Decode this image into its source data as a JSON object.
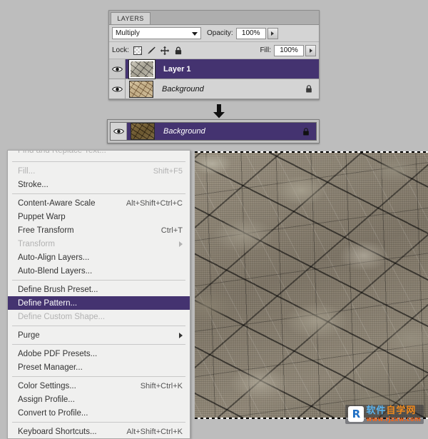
{
  "app": {
    "background_color": "#bdbdbd",
    "selection_purple": "#443370"
  },
  "layers_panel": {
    "tab_label": "LAYERS",
    "blend_mode": {
      "value": "Multiply",
      "icon": "chevron-down-icon"
    },
    "opacity": {
      "label": "Opacity:",
      "value": "100%"
    },
    "fill": {
      "label": "Fill:",
      "value": "100%"
    },
    "lock": {
      "label": "Lock:",
      "icons": [
        "lock-transparent-pixels-icon",
        "lock-image-pixels-icon",
        "lock-position-icon",
        "lock-all-icon"
      ]
    },
    "layers": [
      {
        "name": "Layer 1",
        "selected": true,
        "visible": true,
        "locked": false,
        "italic": false,
        "thumbnail": "gray-cracked-texture"
      },
      {
        "name": "Background",
        "selected": false,
        "visible": true,
        "locked": true,
        "italic": true,
        "thumbnail": "tan-cracked-texture"
      }
    ]
  },
  "flow_arrow": {
    "icon": "arrow-down-icon"
  },
  "result_panel": {
    "layer": {
      "name": "Background",
      "selected": true,
      "visible": true,
      "locked": true,
      "italic": true,
      "thumbnail": "dark-brown-cracked-texture"
    }
  },
  "edit_menu": {
    "items": [
      {
        "label": "Find and Replace Text...",
        "shortcut": "",
        "state": "clipped",
        "submenu": false
      },
      {
        "separator": true
      },
      {
        "label": "Fill...",
        "shortcut": "Shift+F5",
        "state": "disabled",
        "submenu": false
      },
      {
        "label": "Stroke...",
        "shortcut": "",
        "state": "normal",
        "submenu": false
      },
      {
        "separator": true
      },
      {
        "label": "Content-Aware Scale",
        "shortcut": "Alt+Shift+Ctrl+C",
        "state": "normal",
        "submenu": false
      },
      {
        "label": "Puppet Warp",
        "shortcut": "",
        "state": "normal",
        "submenu": false
      },
      {
        "label": "Free Transform",
        "shortcut": "Ctrl+T",
        "state": "normal",
        "submenu": false
      },
      {
        "label": "Transform",
        "shortcut": "",
        "state": "disabled",
        "submenu": true
      },
      {
        "label": "Auto-Align Layers...",
        "shortcut": "",
        "state": "normal",
        "submenu": false
      },
      {
        "label": "Auto-Blend Layers...",
        "shortcut": "",
        "state": "normal",
        "submenu": false
      },
      {
        "separator": true
      },
      {
        "label": "Define Brush Preset...",
        "shortcut": "",
        "state": "normal",
        "submenu": false
      },
      {
        "label": "Define Pattern...",
        "shortcut": "",
        "state": "highlighted",
        "submenu": false
      },
      {
        "label": "Define Custom Shape...",
        "shortcut": "",
        "state": "disabled",
        "submenu": false
      },
      {
        "separator": true
      },
      {
        "label": "Purge",
        "shortcut": "",
        "state": "normal",
        "submenu": true
      },
      {
        "separator": true
      },
      {
        "label": "Adobe PDF Presets...",
        "shortcut": "",
        "state": "normal",
        "submenu": false
      },
      {
        "label": "Preset Manager...",
        "shortcut": "",
        "state": "normal",
        "submenu": false
      },
      {
        "separator": true
      },
      {
        "label": "Color Settings...",
        "shortcut": "Shift+Ctrl+K",
        "state": "normal",
        "submenu": false
      },
      {
        "label": "Assign Profile...",
        "shortcut": "",
        "state": "normal",
        "submenu": false
      },
      {
        "label": "Convert to Profile...",
        "shortcut": "",
        "state": "normal",
        "submenu": false
      },
      {
        "separator": true
      },
      {
        "label": "Keyboard Shortcuts...",
        "shortcut": "Alt+Shift+Ctrl+K",
        "state": "normal",
        "submenu": false
      }
    ]
  },
  "canvas": {
    "content": "cracked-dry-earth-texture",
    "selection_marquee": true
  },
  "watermark": {
    "logo_letter": "R",
    "cn_part1": "软件",
    "cn_part2": "自学网",
    "url": "www.rjzxw.com"
  }
}
